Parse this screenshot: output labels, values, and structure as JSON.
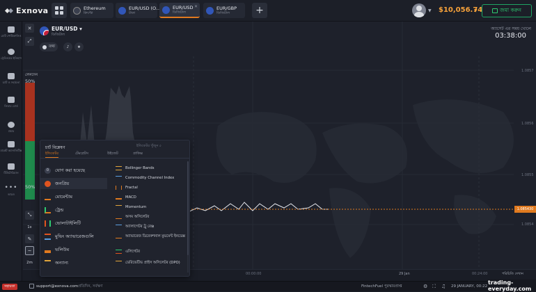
{
  "brand": {
    "name": "Exnova"
  },
  "tabs": [
    {
      "name": "Ethereum",
      "sub": "ক্রিপ্টো",
      "color": "#3a3f4e"
    },
    {
      "name": "EUR/USD (O...",
      "sub": "টাকা",
      "color": "#3156b8"
    },
    {
      "name": "EUR/USD",
      "sub": "ডিজিটাল",
      "color": "#3156b8"
    },
    {
      "name": "EUR/GBP",
      "sub": "ডিজিটাল",
      "color": "#3156b8"
    }
  ],
  "header": {
    "balance": "$10,056.74",
    "deposit_label": "জমা করুন",
    "plus": "+"
  },
  "sidebar": [
    {
      "label": "মোট পোর্টফোলিও"
    },
    {
      "label": "ট্রেডিংয়ের ইতিহাস"
    },
    {
      "label": "চ্যাট ও সহায়তা"
    },
    {
      "label": "লিডার বোর্ড"
    },
    {
      "label": "প্রচার"
    },
    {
      "label": "মার্কেট অ্যানালিটিক্স"
    },
    {
      "label": "টিউটোরিয়াল"
    },
    {
      "label": "আরও"
    }
  ],
  "asset": {
    "name": "EUR/USD",
    "sub": "ডিজিটাল",
    "info": "তথ্য"
  },
  "timer": {
    "label": "অ্যাসেট এর সময় খোলে",
    "value": "03:38:00"
  },
  "sentiment": {
    "up_label": "লেনদেন",
    "up_pct": "50%",
    "down_pct": "50%"
  },
  "prices": {
    "p1": "1.0857",
    "p2": "1.0856",
    "p3": "1.0855",
    "current": "1.085430",
    "p4": "1.0854"
  },
  "tools": {
    "close": "✕",
    "pen": "✎",
    "time": "2m"
  },
  "timeline": {
    "t1": "00:00:00",
    "date": "29 Jan",
    "t2": "00:24:00",
    "right": "পরিচিতি দেখান"
  },
  "panel": {
    "title": "চার্ট বিশ্লেষণ",
    "search": "ইন্ডিকেটর খুঁজুন",
    "tabs": [
      "ইন্ডিকেটর",
      "টেমপ্লেটস",
      "উইজেট",
      "গ্রাফিক্স"
    ],
    "categories": [
      {
        "label": "যোগ করা হয়েছে",
        "icon": "0"
      },
      {
        "label": "জনপ্রিয়"
      },
      {
        "label": "মোমেন্টাম"
      },
      {
        "label": "ট্রেন্ড"
      },
      {
        "label": "ভোলাটাইলিটি"
      },
      {
        "label": "মুভিং অ্যাভারেজগুলি"
      },
      {
        "label": "ভলিউম"
      },
      {
        "label": "অন্যান্য"
      }
    ],
    "indicators": [
      {
        "label": "Bollinger Bands",
        "color": "#e0a43b"
      },
      {
        "label": "Commodity Channel Index",
        "color": "#5a9ee0"
      },
      {
        "label": "Fractal",
        "color": "#e07a1f"
      },
      {
        "label": "MACD",
        "color": "#e07a1f"
      },
      {
        "label": "Momentum",
        "color": "#e0a43b"
      },
      {
        "label": "অসম অসিলেটর",
        "color": "#e07a1f"
      },
      {
        "label": "অ্যালাগেটর ট্রু রেঞ্জ",
        "color": "#5a9ee0"
      },
      {
        "label": "অ্যাভারেজ ডিরেকশনাল মুভমেন্ট ইনডেক্স",
        "color": "#e07a1f"
      },
      {
        "label": "এলিগেটর",
        "color": "#2ecc71"
      },
      {
        "label": "ডেরিভেটিভ প্রাইস অসিলেটর (DPO)",
        "color": "#e0a43b"
      }
    ]
  },
  "footer": {
    "support_badge": "সহায়তা",
    "email": "support@exnova.com",
    "note": "প্রতিদিন, সর্বক্ষণ",
    "fintech": "FintechFuel পুরস্কারপ্রাপ্ত",
    "clock_date": "29 JANUARY, 00:22:31 GMT",
    "watermark": "trading-everyday.com"
  }
}
